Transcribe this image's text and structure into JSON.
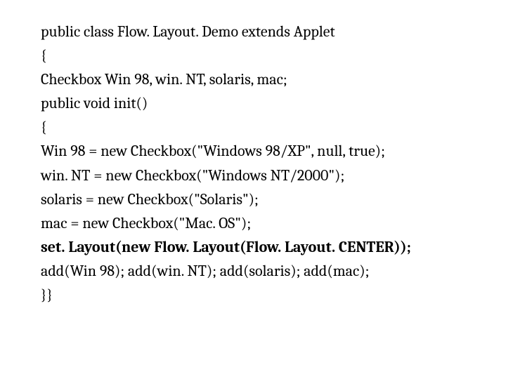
{
  "code": {
    "l1": "public class Flow. Layout. Demo extends Applet",
    "l2": "{",
    "l3": "Checkbox Win 98, win. NT, solaris, mac;",
    "l4": "public void init()",
    "l5": "{",
    "l6": "Win 98 = new Checkbox(\"Windows 98/XP\", null, true);",
    "l7": "win. NT = new Checkbox(\"Windows NT/2000\");",
    "l8": "solaris = new Checkbox(\"Solaris\");",
    "l9": "mac = new Checkbox(\"Mac. OS\");",
    "l10": "set. Layout(new Flow. Layout(Flow. Layout. CENTER));",
    "l11": "add(Win 98); add(win. NT); add(solaris); add(mac);",
    "l12": "}}"
  }
}
